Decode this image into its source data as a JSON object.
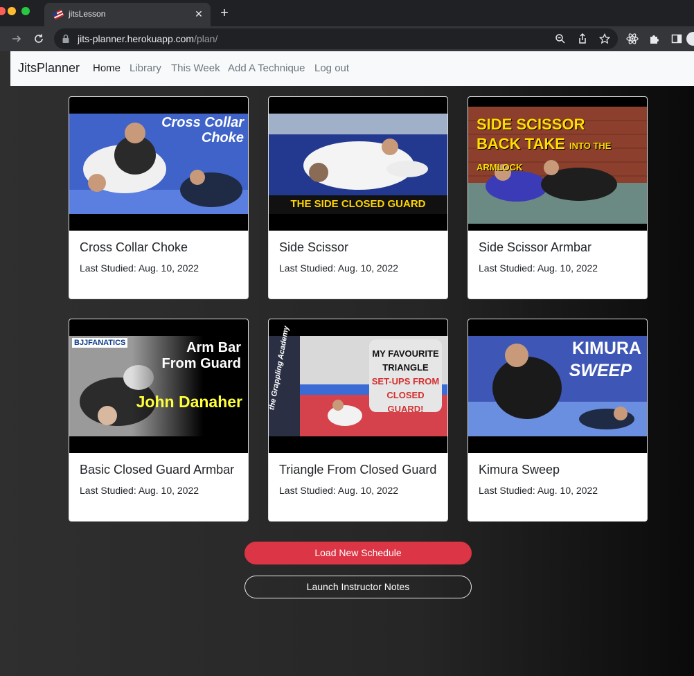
{
  "browser": {
    "tab_title": "jitsLesson",
    "tab_close": "✕",
    "new_tab": "+",
    "url_host": "jits-planner.herokuapp.com",
    "url_path": "/plan/"
  },
  "navbar": {
    "brand": "JitsPlanner",
    "links": [
      "Home",
      "Library",
      "This Week",
      "Add A Technique",
      "Log out"
    ],
    "active": "Home"
  },
  "cards": [
    {
      "title": "Cross Collar Choke",
      "date": "Last Studied: Aug. 10, 2022",
      "thumb_lines": [
        "Cross Collar",
        "Choke"
      ]
    },
    {
      "title": "Side Scissor",
      "date": "Last Studied: Aug. 10, 2022",
      "thumb_lines": [
        "THE SIDE CLOSED GUARD"
      ]
    },
    {
      "title": "Side Scissor Armbar",
      "date": "Last Studied: Aug. 10, 2022",
      "thumb_lines": [
        "SIDE SCISSOR",
        "BACK TAKE",
        "INTO THE ARMLOCK"
      ]
    },
    {
      "title": "Basic Closed Guard Armbar",
      "date": "Last Studied: Aug. 10, 2022",
      "thumb_lines": [
        "Arm Bar",
        "From Guard",
        "John Danaher",
        "BJJFANATICS"
      ]
    },
    {
      "title": "Triangle From Closed Guard",
      "date": "Last Studied: Aug. 10, 2022",
      "thumb_lines": [
        "MY FAVOURITE",
        "TRIANGLE",
        "SET-UPS FROM",
        "CLOSED GUARD!",
        "the Grappling Academy"
      ]
    },
    {
      "title": "Kimura Sweep",
      "date": "Last Studied: Aug. 10, 2022",
      "thumb_lines": [
        "KIMURA",
        "SWEEP"
      ]
    }
  ],
  "buttons": {
    "load_schedule": "Load New Schedule",
    "instructor_notes": "Launch Instructor Notes"
  },
  "colors": {
    "danger": "#dc3545",
    "navbar_bg": "#f8f9fa",
    "chrome_bg": "#35363a"
  }
}
